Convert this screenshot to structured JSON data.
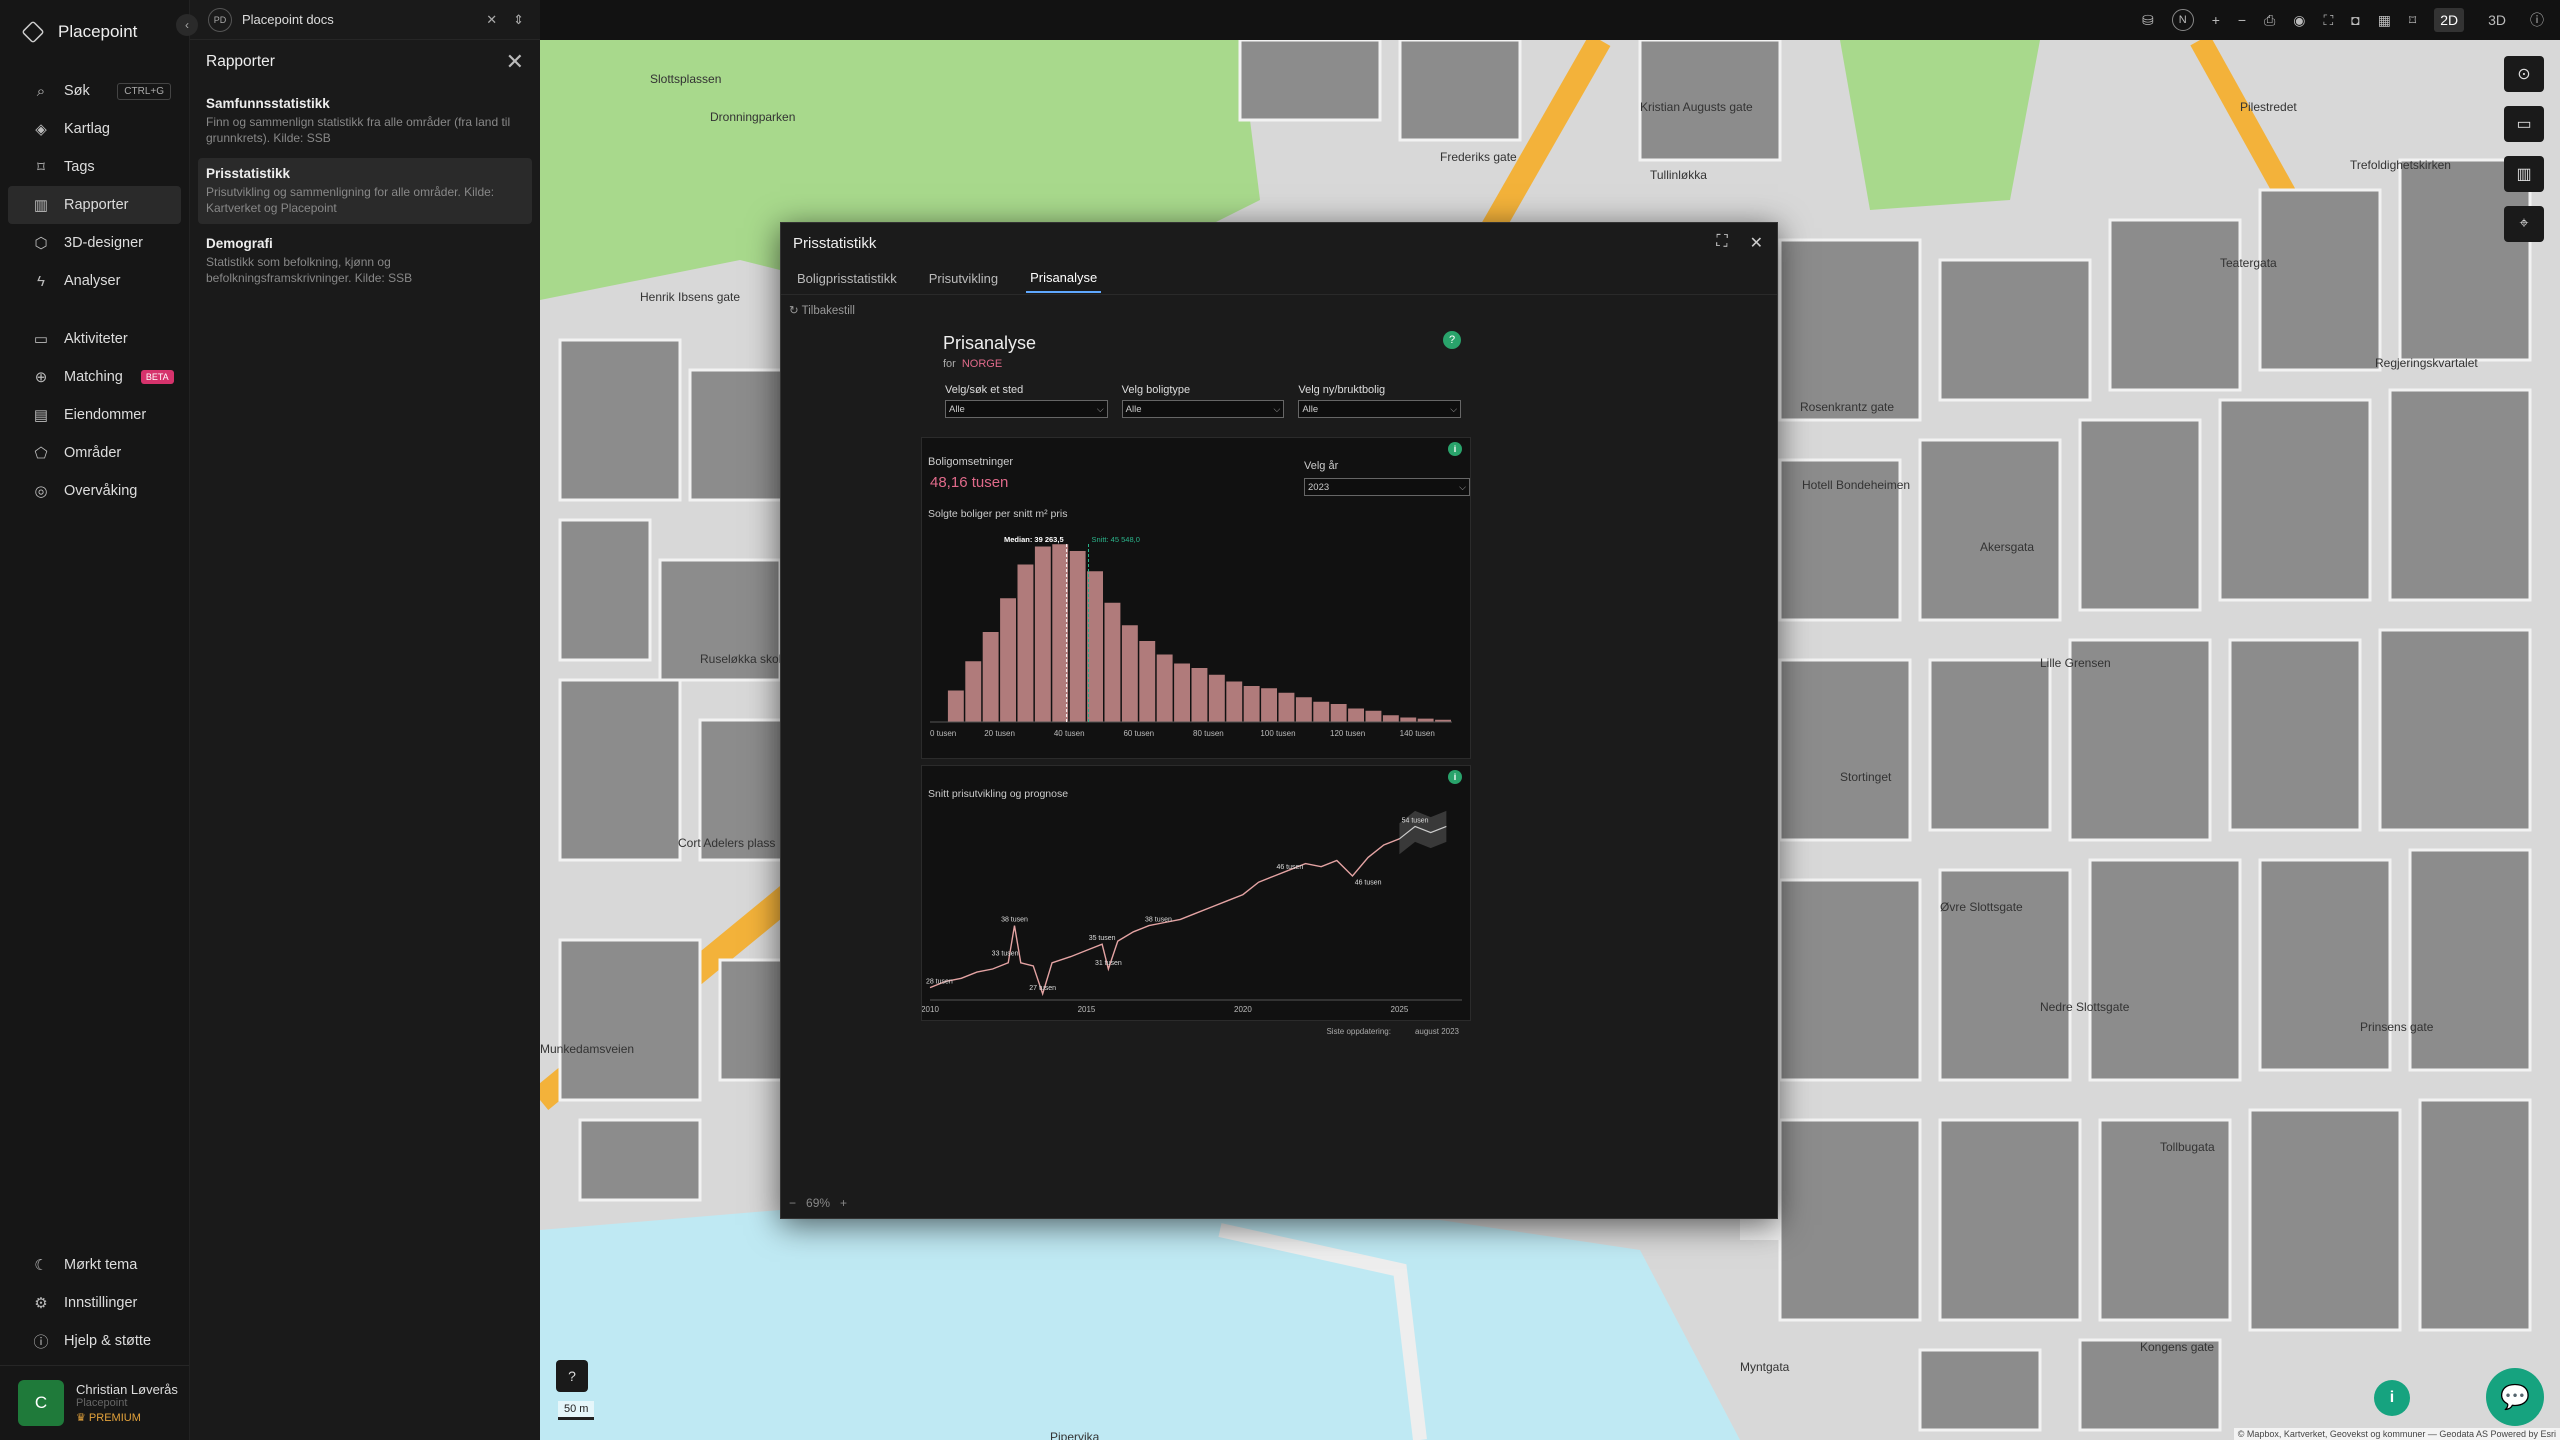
{
  "app": {
    "name": "Placepoint"
  },
  "nav": {
    "search": "Søk",
    "search_shortcut": "CTRL+G",
    "items": [
      "Kartlag",
      "Tags",
      "Rapporter",
      "3D-designer",
      "Analyser"
    ],
    "items2": [
      "Aktiviteter",
      "Matching",
      "Eiendommer",
      "Områder",
      "Overvåking"
    ],
    "beta": "BETA",
    "bottom": [
      "Mørkt tema",
      "Innstillinger",
      "Hjelp & støtte"
    ]
  },
  "user": {
    "name": "Christian Løverås",
    "org": "Placepoint",
    "plan": "PREMIUM",
    "initial": "C"
  },
  "doc": {
    "badge": "PD",
    "title": "Placepoint docs"
  },
  "panel": {
    "title": "Rapporter",
    "reports": [
      {
        "title": "Samfunnsstatistikk",
        "desc": "Finn og sammenlign statistikk fra alle områder (fra land til grunnkrets). Kilde: SSB"
      },
      {
        "title": "Prisstatistikk",
        "desc": "Prisutvikling og sammenligning for alle områder. Kilde: Kartverket og Placepoint"
      },
      {
        "title": "Demografi",
        "desc": "Statistikk som befolkning, kjønn og befolkningsframskrivninger. Kilde: SSB"
      }
    ]
  },
  "topbar": {
    "mode2d": "2D",
    "mode3d": "3D",
    "north": "N"
  },
  "map": {
    "scale": "50 m",
    "attribution": "© Mapbox, Kartverket, Geovekst og kommuner — Geodata AS Powered by Esri",
    "labels": [
      "Slottsplassen",
      "Dronningparken",
      "Henrik Ibsens gate",
      "Ruseløkka skole",
      "Cort Adelers plass",
      "Munkedamsveien",
      "Tullinløkka",
      "Frederiks gate",
      "Kristian Augusts gate",
      "Pilestredet",
      "Teatergata",
      "Regjeringskvartalet",
      "Hotell Bondeheimen",
      "Lille Grensen",
      "Stortinget",
      "Akersgata",
      "Rosenkrantz gate",
      "Tollbugata",
      "Prinsens gate",
      "Myntgata",
      "Kongens gate",
      "Nedre Slottsgate",
      "Øvre Slottsgate",
      "Pipervika",
      "Trefoldighetskirken"
    ]
  },
  "modal": {
    "title": "Prisstatistikk",
    "tabs": [
      "Boligprisstatistikk",
      "Prisutvikling",
      "Prisanalyse"
    ],
    "reset": "Tilbakestill",
    "report_title": "Prisanalyse",
    "for_label": "for",
    "for_value": "NORGE",
    "help": "?",
    "filters": [
      {
        "label": "Velg/søk et sted",
        "value": "Alle"
      },
      {
        "label": "Velg boligtype",
        "value": "Alle"
      },
      {
        "label": "Velg ny/bruktbolig",
        "value": "Alle"
      }
    ],
    "sales_label": "Boligomsetninger",
    "sales_value": "48,16 tusen",
    "year_label": "Velg år",
    "year_value": "2023",
    "updated_label": "Siste oppdatering:",
    "updated_value": "august 2023",
    "zoom": "69%"
  },
  "chart_data": [
    {
      "type": "bar",
      "title": "Solgte boliger per snitt m² pris",
      "xlabel": "",
      "ylabel": "",
      "x_tick_labels": [
        "0 tusen",
        "20 tusen",
        "40 tusen",
        "60 tusen",
        "80 tusen",
        "100 tusen",
        "120 tusen",
        "140 tusen"
      ],
      "x_ticks": [
        0,
        20000,
        40000,
        60000,
        80000,
        100000,
        120000,
        140000
      ],
      "bin_width": 5000,
      "bin_starts": [
        5000,
        10000,
        15000,
        20000,
        25000,
        30000,
        35000,
        40000,
        45000,
        50000,
        55000,
        60000,
        65000,
        70000,
        75000,
        80000,
        85000,
        90000,
        95000,
        100000,
        105000,
        110000,
        115000,
        120000,
        125000,
        130000,
        135000,
        140000,
        145000
      ],
      "values": [
        14,
        27,
        40,
        55,
        70,
        78,
        79,
        76,
        67,
        53,
        43,
        36,
        30,
        26,
        24,
        21,
        18,
        16,
        15,
        13,
        11,
        9,
        8,
        6,
        5,
        3,
        2,
        1.5,
        1
      ],
      "ylim": [
        0,
        80
      ],
      "annotations": [
        {
          "label": "Median: 39 263,5",
          "x": 39263.5
        },
        {
          "label": "Snitt: 45 548,0",
          "x": 45548
        }
      ]
    },
    {
      "type": "line",
      "title": "Snitt prisutvikling og prognose",
      "x_tick_labels": [
        "2010",
        "2015",
        "2020",
        "2025"
      ],
      "xlim": [
        2010,
        2027
      ],
      "ylim": [
        26,
        56
      ],
      "series": [],
      "points": [
        [
          2010,
          28
        ],
        [
          2010.5,
          29
        ],
        [
          2011,
          29.5
        ],
        [
          2011.5,
          30.5
        ],
        [
          2012,
          31
        ],
        [
          2012.5,
          32
        ],
        [
          2012.7,
          38
        ],
        [
          2012.9,
          32
        ],
        [
          2013.3,
          31.5
        ],
        [
          2013.6,
          27
        ],
        [
          2013.9,
          32
        ],
        [
          2014.5,
          33
        ],
        [
          2015,
          34
        ],
        [
          2015.5,
          35
        ],
        [
          2015.7,
          31
        ],
        [
          2016,
          35.5
        ],
        [
          2016.5,
          37
        ],
        [
          2017,
          38
        ],
        [
          2017.5,
          38.5
        ],
        [
          2018,
          39
        ],
        [
          2018.5,
          40
        ],
        [
          2019,
          41
        ],
        [
          2019.5,
          42
        ],
        [
          2020,
          43
        ],
        [
          2020.5,
          45
        ],
        [
          2021,
          46
        ],
        [
          2021.5,
          47
        ],
        [
          2022,
          48
        ],
        [
          2022.5,
          47.5
        ],
        [
          2023,
          48.5
        ],
        [
          2023.5,
          46
        ],
        [
          2024,
          49
        ],
        [
          2024.5,
          51
        ],
        [
          2025,
          52
        ],
        [
          2025.5,
          54
        ],
        [
          2026,
          53
        ],
        [
          2026.5,
          54
        ]
      ],
      "forecast_start": 2025.4,
      "annotations": [
        {
          "label": "28 tusen",
          "x": 2010.3,
          "y": 28
        },
        {
          "label": "33 tusen",
          "x": 2012.4,
          "y": 32.5
        },
        {
          "label": "38 tusen",
          "x": 2012.7,
          "y": 38
        },
        {
          "label": "27 tusen",
          "x": 2013.6,
          "y": 27
        },
        {
          "label": "35 tusen",
          "x": 2015.5,
          "y": 35
        },
        {
          "label": "31 tusen",
          "x": 2015.7,
          "y": 31
        },
        {
          "label": "38 tusen",
          "x": 2017.3,
          "y": 38
        },
        {
          "label": "46 tusen",
          "x": 2021.5,
          "y": 46.5
        },
        {
          "label": "46 tusen",
          "x": 2024,
          "y": 44
        },
        {
          "label": "54 tusen",
          "x": 2025.5,
          "y": 54
        }
      ]
    }
  ]
}
